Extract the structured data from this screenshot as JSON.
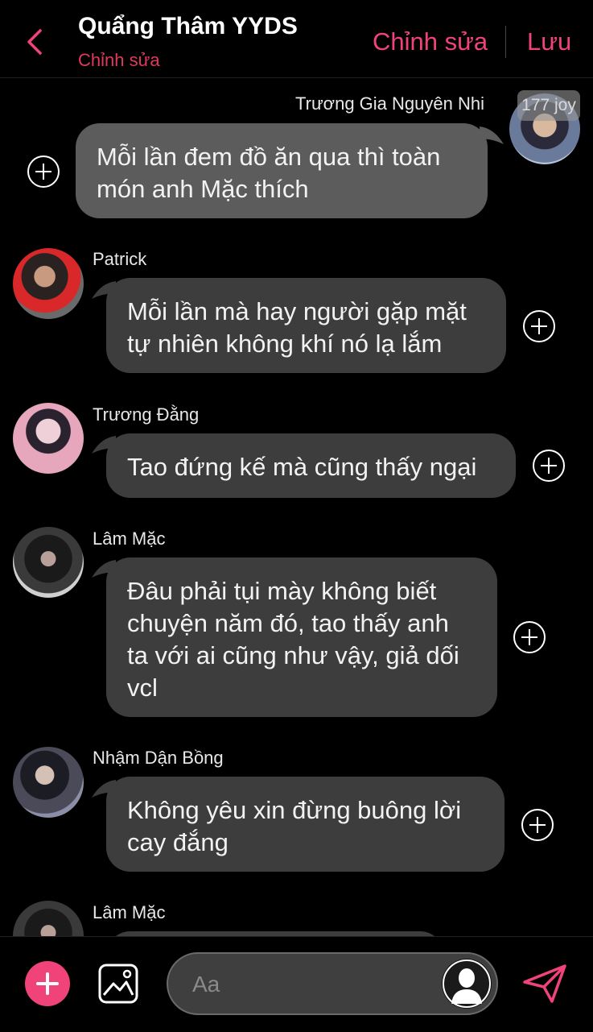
{
  "header": {
    "title": "Quẩng Thâm YYDS",
    "subtitle": "Chỉnh sửa",
    "edit_label": "Chỉnh sửa",
    "save_label": "Lưu",
    "accent": "#f0437a"
  },
  "messages": [
    {
      "sender": "Trương Gia Nguyên Nhi",
      "text": "Mỗi lần đem đồ ăn qua thì toàn món anh Mặc thích",
      "side": "right",
      "badge": "177 joy"
    },
    {
      "sender": "Patrick",
      "text": "Mỗi lần mà hay người gặp mặt tự nhiên không khí nó lạ lắm",
      "side": "left"
    },
    {
      "sender": "Trương Đằng",
      "text": "Tao đứng kế mà cũng thấy ngại",
      "side": "left"
    },
    {
      "sender": "Lâm Mặc",
      "text": "Đâu phải tụi mày không biết chuyện năm đó, tao thấy anh ta với ai cũng như vậy, giả dối vcl",
      "side": "left"
    },
    {
      "sender": "Nhậm Dận Bồng",
      "text": "Không yêu xin đừng buông lời cay đắng",
      "side": "left"
    },
    {
      "sender": "Lâm Mặc",
      "text": "",
      "side": "left"
    }
  ],
  "composer": {
    "placeholder": "Aa",
    "icons": [
      "plus-icon",
      "image-icon",
      "person-icon",
      "send-icon"
    ]
  }
}
